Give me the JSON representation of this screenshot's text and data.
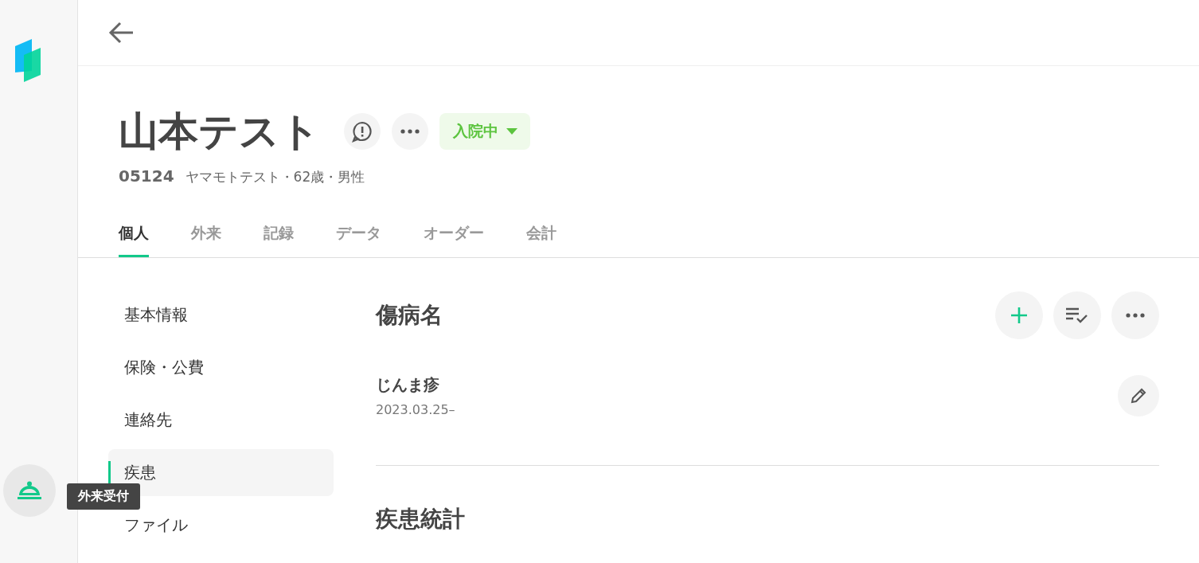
{
  "rail": {
    "reception_button": {
      "tooltip": "外来受付"
    }
  },
  "patient": {
    "name": "山本テスト",
    "status": {
      "label": "入院中"
    },
    "id": "05124",
    "details": "ヤマモトテスト・62歳・男性"
  },
  "tabs": [
    {
      "label": "個人",
      "selected": true
    },
    {
      "label": "外来",
      "selected": false
    },
    {
      "label": "記録",
      "selected": false
    },
    {
      "label": "データ",
      "selected": false
    },
    {
      "label": "オーダー",
      "selected": false
    },
    {
      "label": "会計",
      "selected": false
    }
  ],
  "section_nav": [
    {
      "label": "基本情報",
      "selected": false
    },
    {
      "label": "保険・公費",
      "selected": false
    },
    {
      "label": "連絡先",
      "selected": false
    },
    {
      "label": "疾患",
      "selected": true
    },
    {
      "label": "ファイル",
      "selected": false
    }
  ],
  "diagnoses": {
    "title": "傷病名",
    "items": [
      {
        "name": "じんま疹",
        "date": "2023.03.25–"
      }
    ]
  },
  "statistics": {
    "title": "疾患統計"
  }
}
